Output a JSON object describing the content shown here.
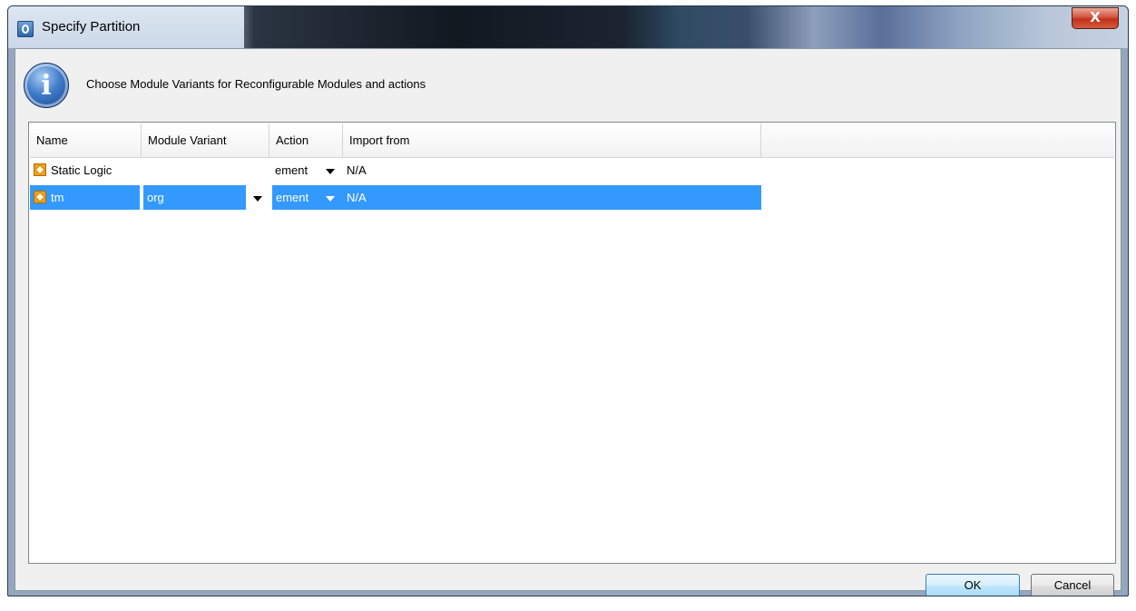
{
  "window": {
    "title": "Specify Partition",
    "close_glyph": "X"
  },
  "info": {
    "icon_glyph": "i",
    "message": "Choose Module Variants for Reconfigurable Modules and actions"
  },
  "table": {
    "columns": [
      "Name",
      "Module Variant",
      "Action",
      "Import from"
    ],
    "rows": [
      {
        "name": "Static Logic",
        "module_variant": "",
        "action": "ement",
        "import_from": "N/A",
        "selected": false
      },
      {
        "name": "tm",
        "module_variant": "org",
        "action": "ement",
        "import_from": "N/A",
        "selected": true
      }
    ]
  },
  "buttons": {
    "ok": "OK",
    "cancel": "Cancel"
  },
  "colors": {
    "selection": "#3399ff",
    "close_button": "#c0301a"
  }
}
